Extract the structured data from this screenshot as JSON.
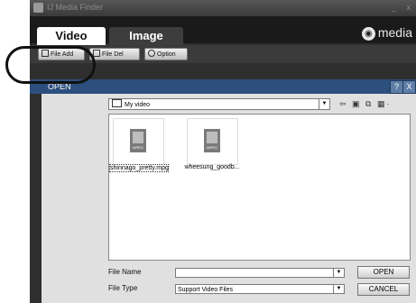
{
  "window": {
    "title": "IJ Media Finder",
    "controls": [
      "_",
      "x"
    ]
  },
  "tabs": [
    {
      "label": "Video",
      "active": true
    },
    {
      "label": "Image",
      "active": false
    }
  ],
  "brand": {
    "name": "media",
    "icon": "brand-logo-icon"
  },
  "toolbar": {
    "file_add": "File Add",
    "file_del": "File Del",
    "option": "Option"
  },
  "open_dialog": {
    "title": "OPEN",
    "help": "?",
    "close": "X",
    "look_in": "My video",
    "nav_icons": "⇦ ▣ ⧉ ▦·",
    "files": [
      {
        "name": "shinnago_pretty.mpg",
        "type": "MPEG",
        "selected": true
      },
      {
        "name": "wheesung_goodb...",
        "type": "MPEG",
        "selected": false
      }
    ],
    "file_name_label": "File Name",
    "file_name_value": "",
    "file_type_label": "File Type",
    "file_type_value": "Support Video Files",
    "open_button": "OPEN",
    "cancel_button": "CANCEL"
  },
  "colors": {
    "dialog_title_bar": "#2c4f7d",
    "app_background": "#2f2f2f",
    "annotation": "#111111"
  }
}
